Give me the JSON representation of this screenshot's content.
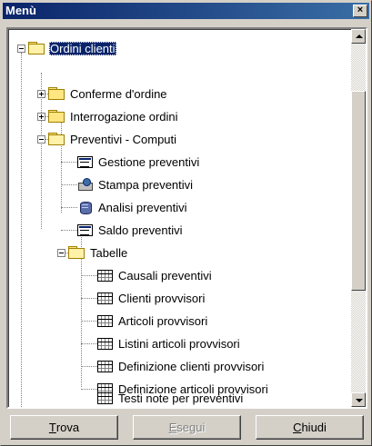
{
  "window": {
    "title": "Menù",
    "close_glyph": "×"
  },
  "tree": {
    "root": {
      "label": "Ordini clienti",
      "expanded": true,
      "selected": true,
      "icon": "folder-open-icon"
    },
    "nodes": [
      {
        "label": "Conferme d'ordine",
        "icon": "folder-icon",
        "expander": "plus"
      },
      {
        "label": "Interrogazione ordini",
        "icon": "folder-icon",
        "expander": "plus"
      },
      {
        "label": "Preventivi - Computi",
        "icon": "folder-open-icon",
        "expander": "minus"
      },
      {
        "label": "Gestione preventivi",
        "icon": "form-icon"
      },
      {
        "label": "Stampa preventivi",
        "icon": "print-preview-icon"
      },
      {
        "label": "Analisi preventivi",
        "icon": "database-icon"
      },
      {
        "label": "Saldo preventivi",
        "icon": "form-icon"
      },
      {
        "label": "Tabelle",
        "icon": "folder-open-icon",
        "expander": "minus"
      },
      {
        "label": "Causali preventivi",
        "icon": "table-icon"
      },
      {
        "label": "Clienti provvisori",
        "icon": "table-icon"
      },
      {
        "label": "Articoli provvisori",
        "icon": "table-icon"
      },
      {
        "label": "Listini articoli provvisori",
        "icon": "table-icon"
      },
      {
        "label": "Definizione clienti provvisori",
        "icon": "table-icon"
      },
      {
        "label": "Definizione articoli provvisori",
        "icon": "table-icon"
      },
      {
        "label": "Testi note per preventivi",
        "icon": "table-icon"
      }
    ]
  },
  "buttons": {
    "trova": {
      "accel": "T",
      "rest": "rova",
      "enabled": true
    },
    "esegui": {
      "accel": "E",
      "rest": "segui",
      "enabled": false
    },
    "chiudi": {
      "accel": "C",
      "rest": "hiudi",
      "enabled": true
    }
  },
  "colors": {
    "titlebar": "#0a246a",
    "selection": "#0a246a",
    "face": "#d4d0c8"
  }
}
